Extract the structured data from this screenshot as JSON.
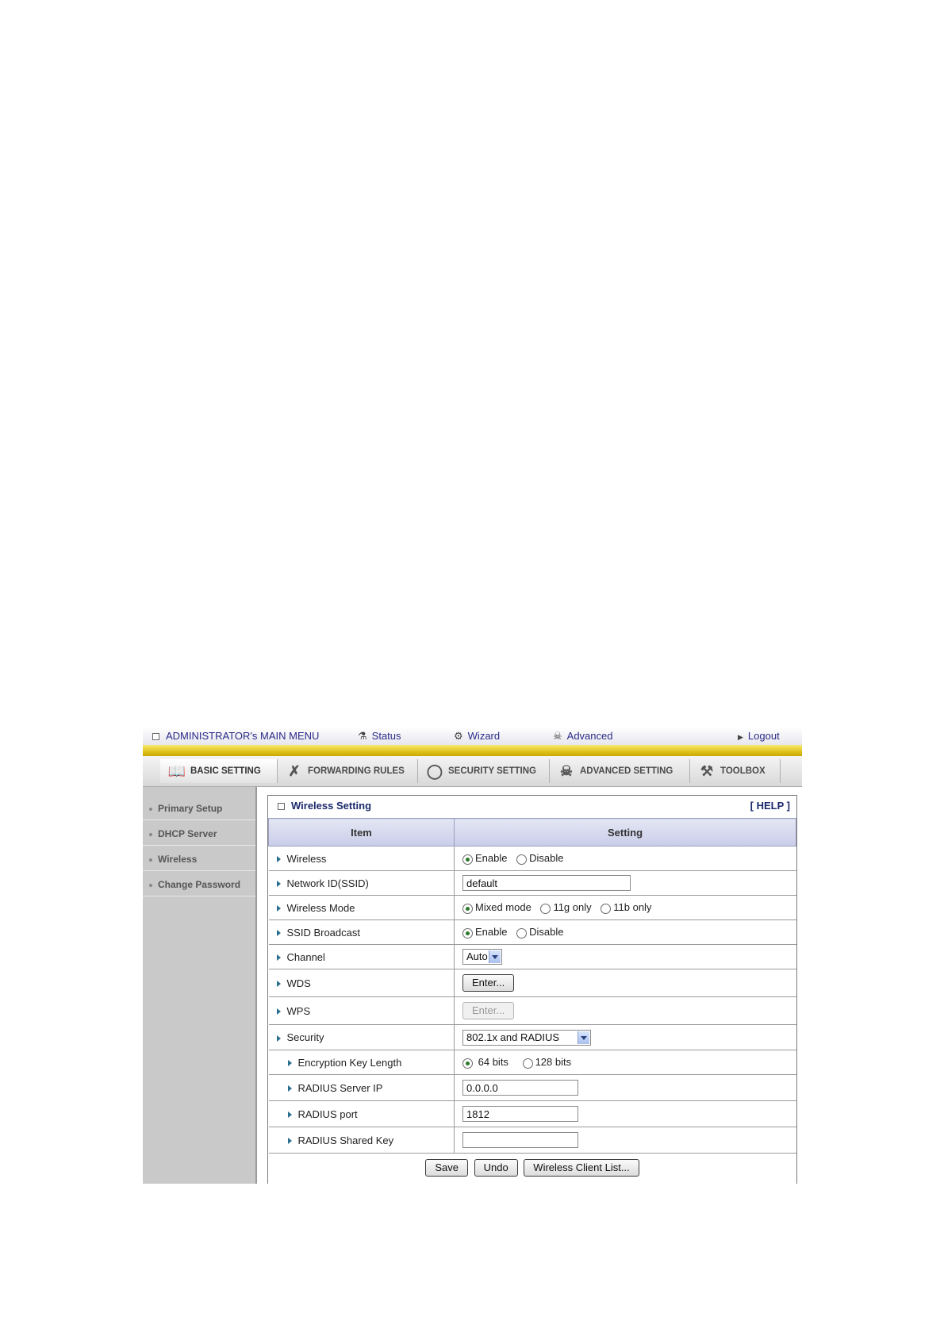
{
  "topmenu": {
    "title": "ADMINISTRATOR's MAIN MENU",
    "status": "Status",
    "wizard": "Wizard",
    "advanced": "Advanced",
    "logout": "Logout"
  },
  "tabs": [
    {
      "label": "BASIC SETTING",
      "icon": "basic-setting-icon",
      "active": true
    },
    {
      "label": "FORWARDING RULES",
      "icon": "forwarding-icon",
      "active": false
    },
    {
      "label": "SECURITY SETTING",
      "icon": "security-icon",
      "active": false
    },
    {
      "label": "ADVANCED SETTING",
      "icon": "advanced-icon",
      "active": false
    },
    {
      "label": "TOOLBOX",
      "icon": "toolbox-icon",
      "active": false
    }
  ],
  "sidebar": {
    "items": [
      {
        "label": "Primary Setup"
      },
      {
        "label": "DHCP Server"
      },
      {
        "label": "Wireless"
      },
      {
        "label": "Change Password"
      }
    ]
  },
  "panel": {
    "title": "Wireless Setting",
    "help": "[ HELP ]",
    "col_item": "Item",
    "col_setting": "Setting"
  },
  "rows": {
    "wireless": {
      "label": "Wireless",
      "enable": "Enable",
      "disable": "Disable",
      "selected": "Enable"
    },
    "ssid": {
      "label": "Network ID(SSID)",
      "value": "default"
    },
    "mode": {
      "label": "Wireless Mode",
      "mixed": "Mixed mode",
      "g": "11g only",
      "b": "11b only",
      "selected": "Mixed mode"
    },
    "broadcast": {
      "label": "SSID Broadcast",
      "enable": "Enable",
      "disable": "Disable",
      "selected": "Enable"
    },
    "channel": {
      "label": "Channel",
      "value": "Auto"
    },
    "wds": {
      "label": "WDS",
      "button": "Enter..."
    },
    "wps": {
      "label": "WPS",
      "button": "Enter..."
    },
    "security": {
      "label": "Security",
      "value": "802.1x and RADIUS"
    },
    "keylen": {
      "label": "Encryption Key Length",
      "opt64": "64 bits",
      "opt128": "128 bits",
      "selected": "64 bits"
    },
    "radius_ip": {
      "label": "RADIUS Server IP",
      "value": "0.0.0.0"
    },
    "radius_port": {
      "label": "RADIUS port",
      "value": "1812"
    },
    "radius_key": {
      "label": "RADIUS Shared Key",
      "value": ""
    }
  },
  "buttons": {
    "save": "Save",
    "undo": "Undo",
    "client_list": "Wireless Client List..."
  },
  "colors": {
    "menu_text": "#2a2a88",
    "gold_bar": "#e0c21a",
    "sidebar_bg": "#c9c9c9",
    "header_bg": "#c9cde8"
  }
}
